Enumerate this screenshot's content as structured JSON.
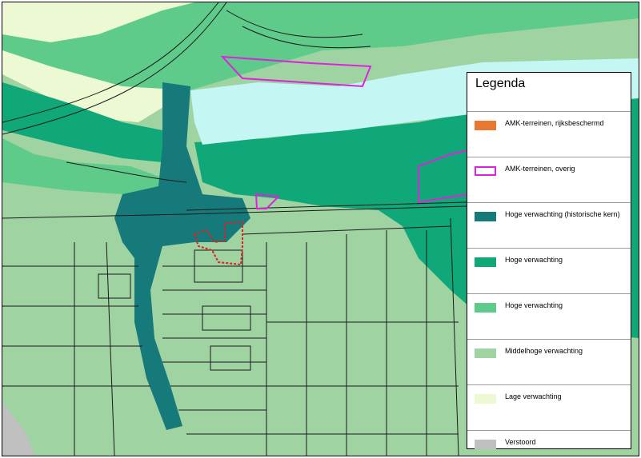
{
  "legend": {
    "title": "Legenda",
    "items": [
      {
        "label": "AMK-terreinen, rijksbeschermd",
        "color": "#e8782f",
        "style": "fill"
      },
      {
        "label": "AMK-terreinen, overig",
        "color": "#dd22dd",
        "style": "outline"
      },
      {
        "label": "Hoge verwachting (historische kern)",
        "color": "#167a7a",
        "style": "fill"
      },
      {
        "label": "Hoge verwachting",
        "color": "#10a878",
        "style": "fill"
      },
      {
        "label": "Hoge verwachting",
        "color": "#5ecb8a",
        "style": "fill"
      },
      {
        "label": "Middelhoge verwachting",
        "color": "#9fd3a2",
        "style": "fill"
      },
      {
        "label": "Lage verwachting",
        "color": "#edf9d2",
        "style": "fill"
      },
      {
        "label": "Verstoord",
        "color": "#c0c0c0",
        "style": "fill"
      }
    ]
  },
  "map": {
    "colors": {
      "water": "#c4f6f3",
      "historic_core": "#167a7a",
      "high": "#10a878",
      "high_light": "#5ecb8a",
      "medium": "#9fd3a2",
      "low": "#edf9d2",
      "disturbed": "#c0c0c0",
      "amk_other": "#dd22dd",
      "amk_protected_outline": "#e02020",
      "lines": "#1a1a1a"
    }
  }
}
